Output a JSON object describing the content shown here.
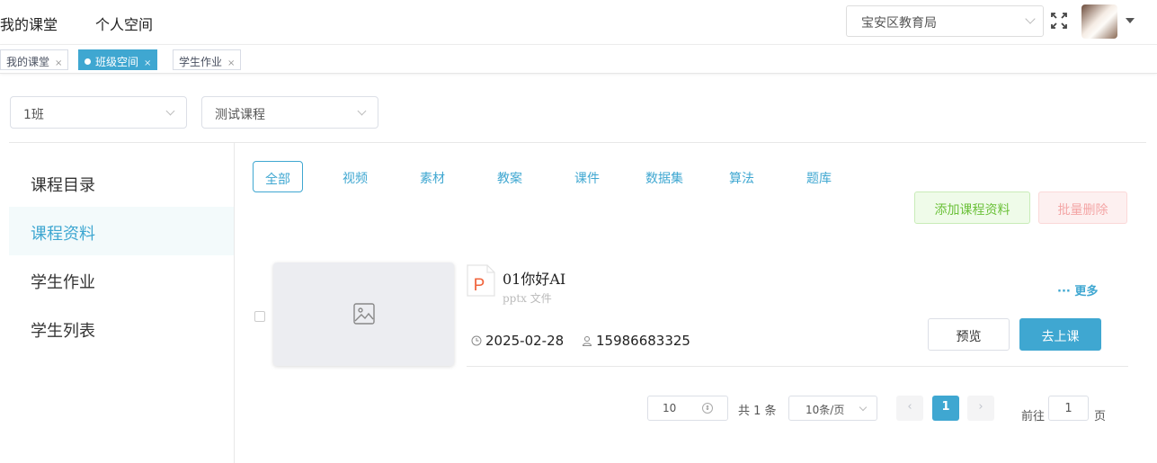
{
  "header": {
    "nav": [
      "我的课堂",
      "个人空间"
    ],
    "org_select": "宝安区教育局"
  },
  "tabs": [
    {
      "label": "我的课堂",
      "close": "×"
    },
    {
      "label": "班级空间",
      "close": "×"
    },
    {
      "label": "学生作业",
      "close": "×"
    }
  ],
  "filters": {
    "class": "1班",
    "course": "测试课程"
  },
  "sidebar": {
    "items": [
      "课程目录",
      "课程资料",
      "学生作业",
      "学生列表"
    ]
  },
  "categories": [
    "全部",
    "视频",
    "素材",
    "教案",
    "课件",
    "数据集",
    "算法",
    "题库"
  ],
  "actions": {
    "add": "添加课程资料",
    "delete": "批量删除"
  },
  "resource": {
    "icon_letter": "P",
    "title": "01你好AI",
    "type": "pptx 文件",
    "date": "2025-02-28",
    "user": "15986683325",
    "more": "··· 更多",
    "preview": "预览",
    "go_class": "去上课"
  },
  "pagination": {
    "page_size": "10",
    "total": "共 1 条",
    "per_page": "10条/页",
    "prev": "‹",
    "current": "1",
    "next": "›",
    "goto_label": "前往",
    "goto_value": "1",
    "page_suffix": "页"
  },
  "colors": {
    "accent": "#3fa7d1",
    "add_green": "#6cc13a",
    "delete_red": "#f4a6a6",
    "ppt_orange": "#f0643c"
  }
}
